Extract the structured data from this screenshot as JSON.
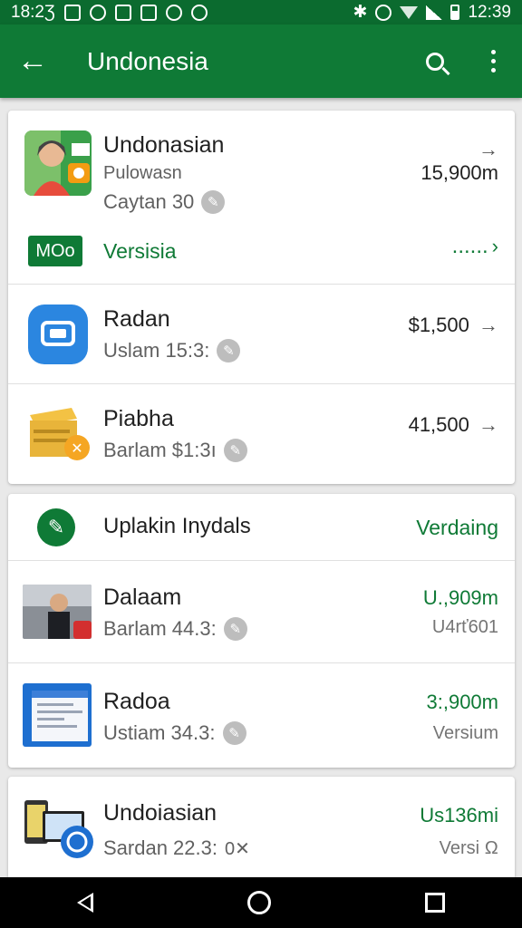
{
  "status_bar": {
    "left_time": "18:2Ʒ",
    "right_time": "12:39"
  },
  "app_bar": {
    "title": "Undonesia"
  },
  "card1": {
    "item": {
      "title": "Undonasian",
      "line2": "Pulowasn",
      "line3": "Caytan 30",
      "price": "15,900m"
    },
    "footer": {
      "chip": "MOo",
      "label": "Versisia",
      "dots": "......"
    }
  },
  "card1_rows": [
    {
      "title": "Radan",
      "sub": "Uslam 15:3:",
      "price": "$1,500"
    },
    {
      "title": "Piabha",
      "sub": "Barlam $1:3ı",
      "price": "41,500"
    }
  ],
  "card2": {
    "header": {
      "title": "Uplakin Inydals",
      "action": "Verdaing"
    },
    "rows": [
      {
        "title": "Dalaam",
        "sub": "Barlam 44.3:",
        "price": "U.,909m",
        "meta": "U4rť601"
      },
      {
        "title": "Radoa",
        "sub": "Ustiam 34.3:",
        "price": "3:,900m",
        "meta": "Versium"
      }
    ]
  },
  "card3": {
    "row": {
      "title": "Undoiasian",
      "sub": "Sardan 22.3:",
      "sub_badge": "0✕",
      "price": "Us136mi",
      "meta": "Versi Ω"
    }
  },
  "colors": {
    "primary": "#0f7a36",
    "status_bar": "#0b6b2f",
    "accent_green": "#0f7a36"
  },
  "icons": {
    "back": "arrow-left-icon",
    "search": "search-icon",
    "more": "more-vert-icon",
    "row_arrow": "chevron-right-icon",
    "badge": "verified-badge-icon",
    "header": "edit-circle-icon"
  }
}
